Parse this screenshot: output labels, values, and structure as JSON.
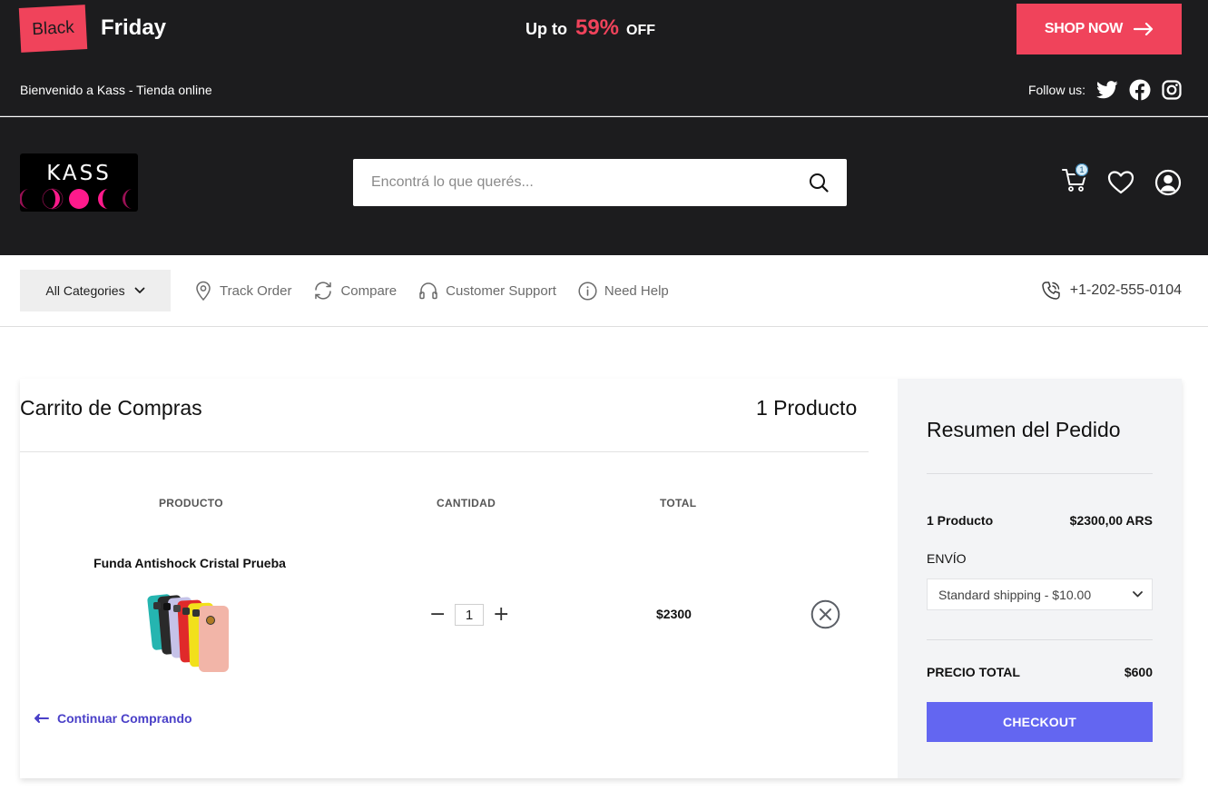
{
  "promo": {
    "black": "Black",
    "friday": "Friday",
    "up_to": "Up to",
    "percent": "59%",
    "off": "OFF",
    "shop_now": "SHOP NOW",
    "welcome": "Bienvenido a Kass  - Tienda online",
    "follow_us": "Follow us:",
    "social_icons": [
      "twitter-icon",
      "facebook-icon",
      "instagram-icon"
    ]
  },
  "header": {
    "logo_text": "KASS",
    "search_placeholder": "Encontrá lo que querés...",
    "cart_count": "1"
  },
  "nav": {
    "all_categories": "All Categories",
    "links": [
      "Track Order",
      "Compare",
      "Customer Support",
      "Need Help"
    ],
    "phone": "+1-202-555-0104"
  },
  "cart": {
    "title": "Carrito de Compras",
    "count_label": "1 Producto",
    "columns": [
      "PRODUCTO",
      "CANTIDAD",
      "TOTAL"
    ],
    "item": {
      "name": "Funda Antishock Cristal Prueba",
      "quantity": "1",
      "total": "$2300"
    },
    "continue_label": "Continuar Comprando"
  },
  "summary": {
    "title": "Resumen del Pedido",
    "products_label": "1 Producto",
    "products_value": "$2300,00 ARS",
    "shipping_label": "ENVÍO",
    "shipping_option": "Standard shipping - $10.00",
    "total_label": "PRECIO TOTAL",
    "total_value": "$600",
    "checkout_label": "CHECKOUT"
  },
  "colors": {
    "accent_red": "#f0435b",
    "dark_bg": "#1c1c1e",
    "checkout": "#6366f1",
    "link": "#4a40c8",
    "logo_pink": "#ff1a8c"
  }
}
